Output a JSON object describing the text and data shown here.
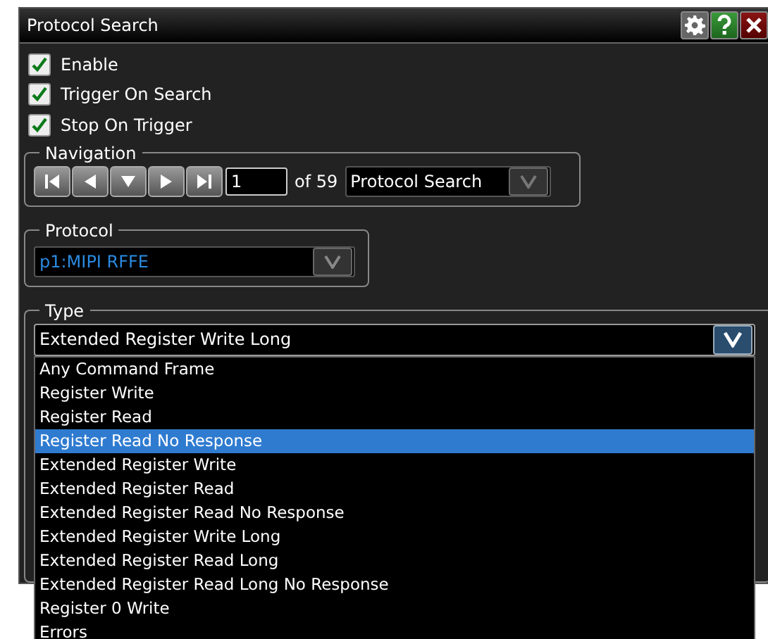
{
  "window": {
    "title": "Protocol Search"
  },
  "options": [
    {
      "label": "Enable",
      "checked": true
    },
    {
      "label": "Trigger On Search",
      "checked": true
    },
    {
      "label": "Stop On Trigger",
      "checked": true
    }
  ],
  "navigation": {
    "label": "Navigation",
    "index": "1",
    "count_text": "of 59",
    "mode": "Protocol Search"
  },
  "protocol": {
    "label": "Protocol",
    "value": "p1:MIPI RFFE"
  },
  "type": {
    "label": "Type",
    "value": "Extended Register Write Long",
    "expanded": true,
    "items": [
      {
        "label": "Any Command Frame",
        "highlighted": false
      },
      {
        "label": "Register Write",
        "highlighted": false
      },
      {
        "label": "Register Read",
        "highlighted": false
      },
      {
        "label": "Register Read No Response",
        "highlighted": true
      },
      {
        "label": "Extended Register Write",
        "highlighted": false
      },
      {
        "label": "Extended Register Read",
        "highlighted": false
      },
      {
        "label": "Extended Register Read No Response",
        "highlighted": false
      },
      {
        "label": "Extended Register Write Long",
        "highlighted": false
      },
      {
        "label": "Extended Register Read Long",
        "highlighted": false
      },
      {
        "label": "Extended Register Read Long No Response",
        "highlighted": false
      },
      {
        "label": "Register 0 Write",
        "highlighted": false
      },
      {
        "label": "Errors",
        "highlighted": false
      }
    ]
  }
}
